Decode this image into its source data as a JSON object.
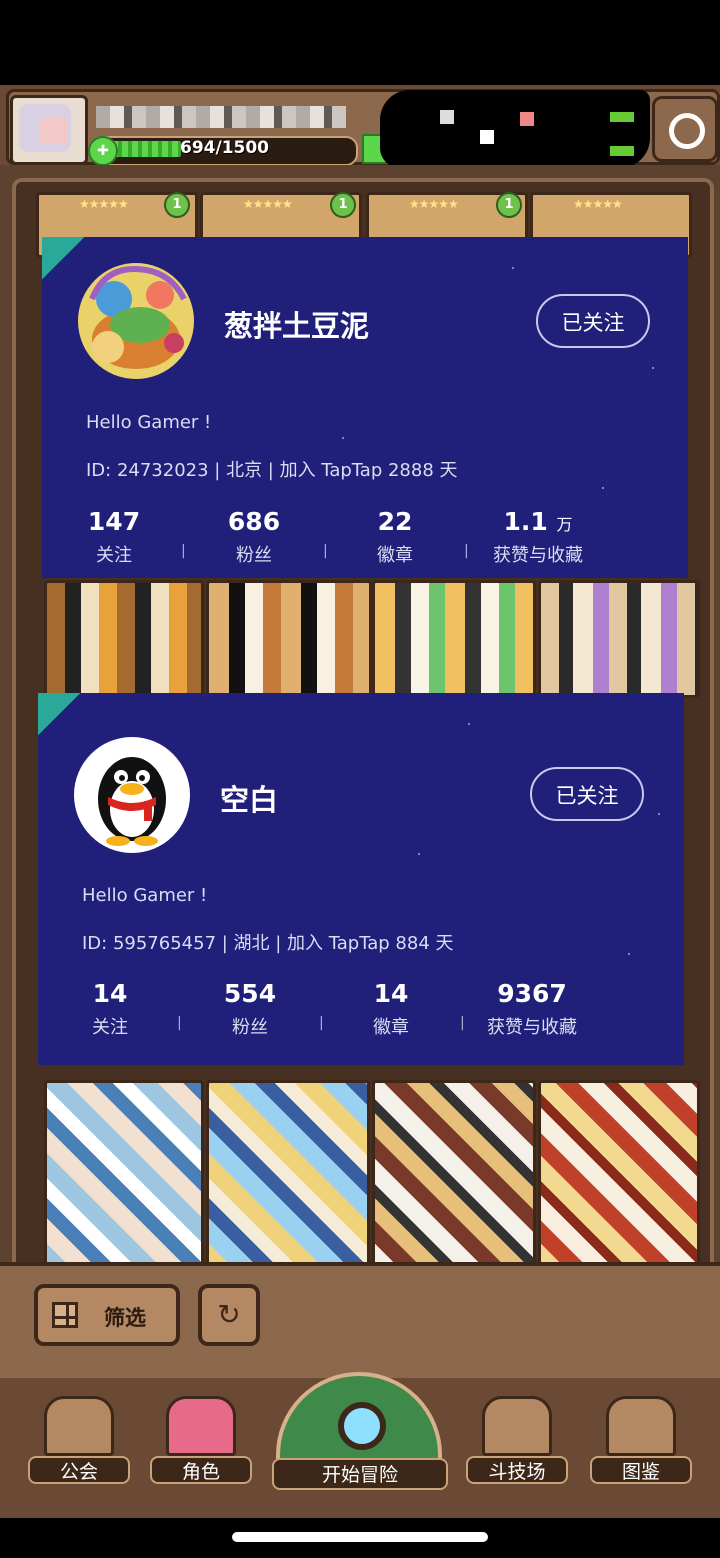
{
  "hud": {
    "energy_text": "694/1500",
    "energy_fraction": 0.463
  },
  "profiles": [
    {
      "name": "葱拌土豆泥",
      "follow_label": "已关注",
      "bio": "Hello Gamer !",
      "meta": "ID: 24732023  |  北京  |  加入 TapTap 2888 天",
      "stats": [
        {
          "value": "147",
          "unit": "",
          "label": "关注"
        },
        {
          "value": "686",
          "unit": "",
          "label": "粉丝"
        },
        {
          "value": "22",
          "unit": "",
          "label": "徽章"
        },
        {
          "value": "1.1",
          "unit": "万",
          "label": "获赞与收藏"
        }
      ]
    },
    {
      "name": "空白",
      "follow_label": "已关注",
      "bio": "Hello Gamer !",
      "meta": "ID: 595765457  |  湖北  |  加入 TapTap 884 天",
      "stats": [
        {
          "value": "14",
          "unit": "",
          "label": "关注"
        },
        {
          "value": "554",
          "unit": "",
          "label": "粉丝"
        },
        {
          "value": "14",
          "unit": "",
          "label": "徽章"
        },
        {
          "value": "9367",
          "unit": "",
          "label": "获赞与收藏"
        }
      ]
    }
  ],
  "cards_top": {
    "stars": "★★★★★",
    "levels": [
      "1",
      "1",
      "1"
    ]
  },
  "controls": {
    "filter_label": "筛选",
    "refresh_icon": "↻"
  },
  "nav": {
    "guild": "公会",
    "character": "角色",
    "adventure": "开始冒险",
    "arena": "斗技场",
    "codex": "图鉴"
  },
  "colors": {
    "profile_bg": "#20207a",
    "accent_teal": "#2aa99a",
    "frame_brown": "#8c684d"
  }
}
